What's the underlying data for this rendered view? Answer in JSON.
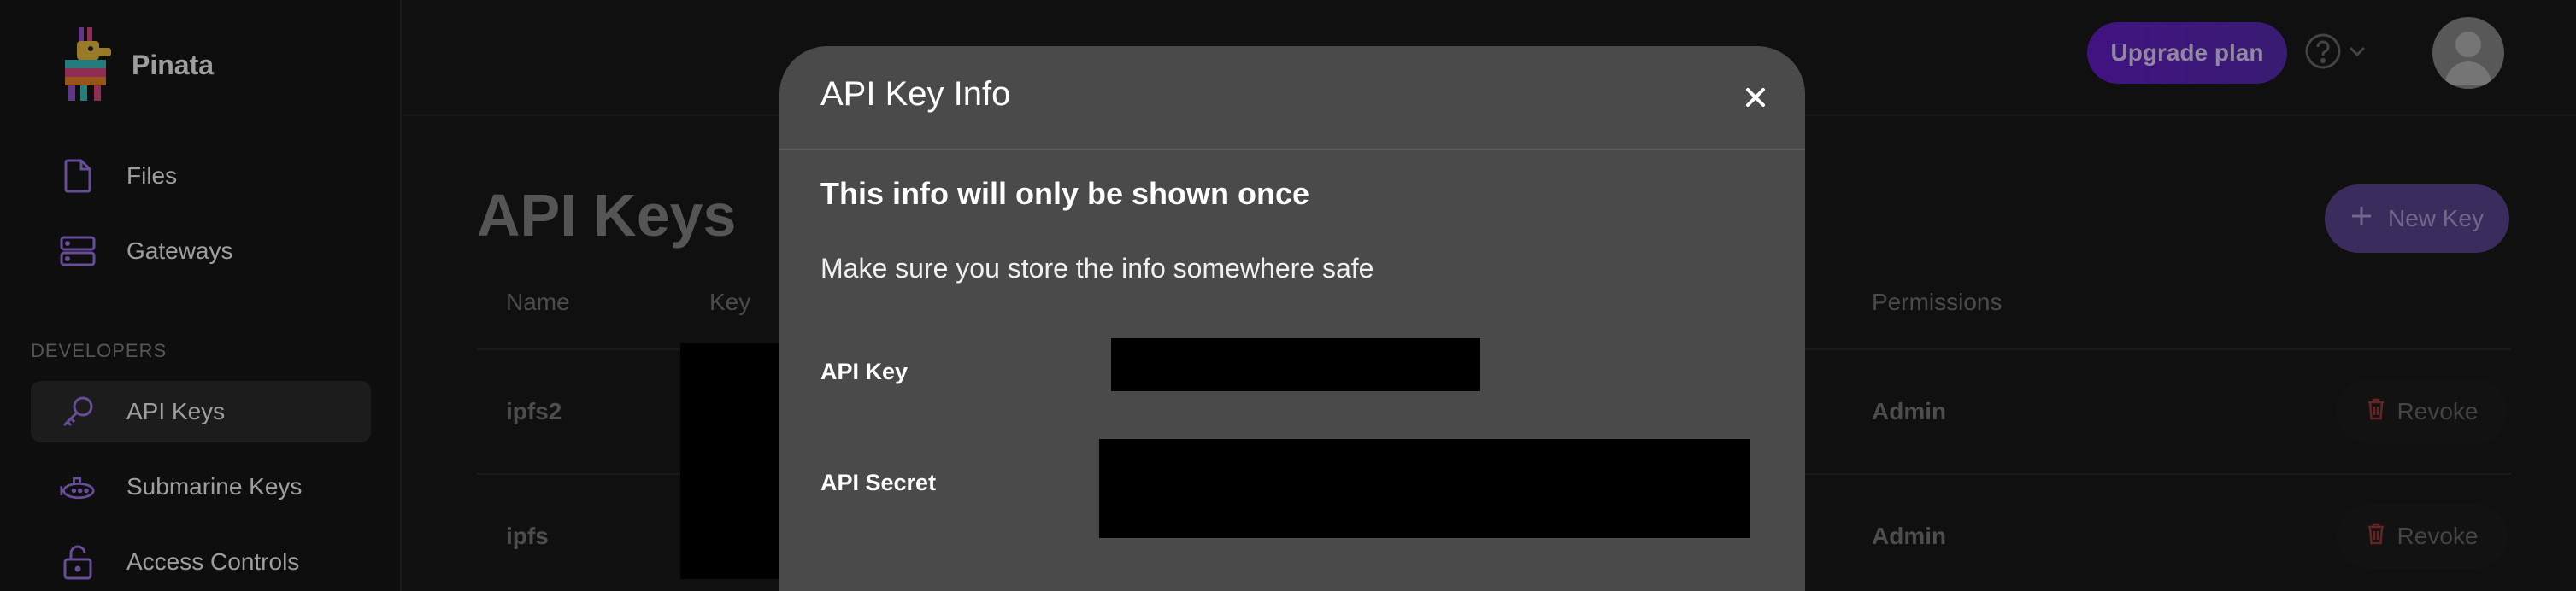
{
  "brand": {
    "name": "Pinata"
  },
  "sidebar": {
    "items": [
      {
        "label": "Files",
        "icon": "file-icon"
      },
      {
        "label": "Gateways",
        "icon": "server-icon"
      }
    ],
    "section_label": "DEVELOPERS",
    "developer_items": [
      {
        "label": "API Keys",
        "icon": "key-icon",
        "active": true
      },
      {
        "label": "Submarine Keys",
        "icon": "submarine-icon"
      },
      {
        "label": "Access Controls",
        "icon": "unlock-icon"
      }
    ]
  },
  "header": {
    "upgrade_label": "Upgrade plan",
    "help_icon": "help-circle-icon"
  },
  "page": {
    "title": "API Keys",
    "new_key_label": "New Key",
    "columns": {
      "name": "Name",
      "key": "Key",
      "permissions": "Permissions"
    },
    "rows": [
      {
        "name": "ipfs2",
        "permissions": "Admin",
        "action": "Revoke"
      },
      {
        "name": "ipfs",
        "permissions": "Admin",
        "action": "Revoke"
      }
    ]
  },
  "modal": {
    "title": "API Key Info",
    "heading": "This info will only be shown once",
    "text": "Make sure you store the info somewhere safe",
    "fields": {
      "api_key": "API Key",
      "api_secret": "API Secret"
    }
  },
  "colors": {
    "accent": "#7b3fe4",
    "upgrade_gradient_start": "#6a1fd1",
    "modal_bg": "#4a4a4a",
    "revoke_red": "#a33a3a"
  }
}
